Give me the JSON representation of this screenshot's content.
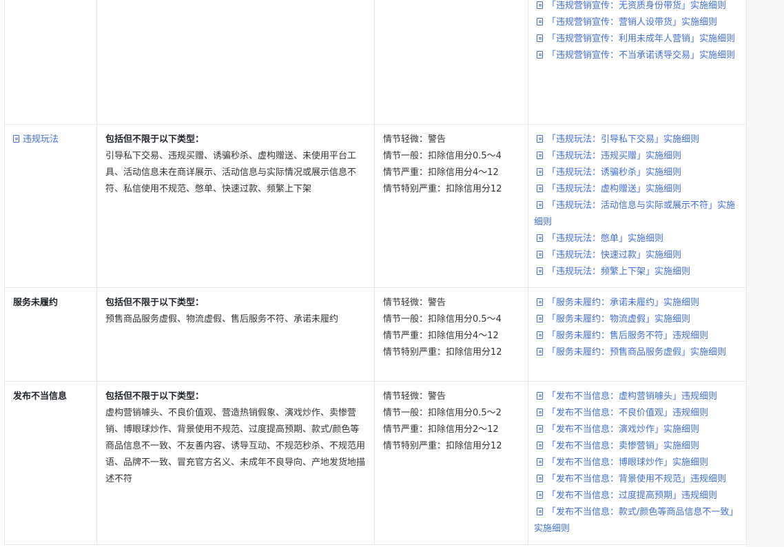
{
  "rows": [
    {
      "type": "",
      "header": "",
      "description": "",
      "penalties": [],
      "rules": [
        "「违规营销宣传：无资质身份带货」实施细则",
        "「违规营销宣传：营销人设带货」实施细则",
        "「违规营销宣传：利用未成年人营销」实施细则",
        "「违规营销宣传：不当承诺诱导交易」实施细则"
      ]
    },
    {
      "type": "违规玩法",
      "header": "包括但不限于以下类型：",
      "description": "引导私下交易、违规买赠、诱骗秒杀、虚构赠送、未使用平台工具、活动信息未在商详展示、活动信息与实际情况或展示信息不符、私信使用不规范、憋单、快速过款、频繁上下架",
      "penalties": [
        "情节轻微：警告",
        "情节一般：扣除信用分0.5～4",
        "情节严重：扣除信用分4～12",
        "情节特别严重：扣除信用分12"
      ],
      "rules": [
        "「违规玩法：引导私下交易」实施细则",
        "「违规玩法：违规买赠」实施细则",
        "「违规玩法：诱骗秒杀」实施细则",
        "「违规玩法：虚构赠送」实施细则",
        "「违规玩法：活动信息与实际或展示不符」实施细则",
        "「违规玩法：憋单」实施细则",
        "「违规玩法：快速过款」实施细则",
        "「违规玩法：频繁上下架」实施细则"
      ]
    },
    {
      "type": "服务未履约",
      "header": "包括但不限于以下类型：",
      "description": "预售商品服务虚假、物流虚假、售后服务不符、承诺未履约",
      "penalties": [
        "情节轻微：警告",
        "情节一般：扣除信用分0.5～4",
        "情节严重：扣除信用分4～12",
        "情节特别严重：扣除信用分12"
      ],
      "rules": [
        "「服务未履约：承诺未履约」实施细则",
        "「服务未履约：物流虚假」实施细则",
        "「服务未履约：售后服务不符」违规细则",
        "「服务未履约：预售商品服务虚假」实施细则"
      ]
    },
    {
      "type": "发布不当信息",
      "header": "包括但不限于以下类型：",
      "description": "虚构营销噱头、不良价值观、营造热销假象、演戏炒作、卖惨营销、博眼球炒作、背景使用不规范、过度提高预期、款式/颜色等商品信息不一致、不友善内容、诱导互动、不规范秒杀、不规范用语、品牌不一致、冒充官方名义、未成年不良导向、产地发货地描述不符",
      "penalties": [
        "情节轻微：警告",
        "情节一般：扣除信用分0.5～2",
        "情节严重：扣除信用分2～12",
        "情节特别严重：扣除信用分12"
      ],
      "rules": [
        "「发布不当信息：虚构营销噱头」违规细则",
        "「发布不当信息：不良价值观」违规细则",
        "「发布不当信息：演戏炒作」实施细则",
        "「发布不当信息：卖惨营销」实施细则",
        "「发布不当信息：博眼球炒作」实施细则",
        "「发布不当信息：背景使用不规范」违规细则",
        "「发布不当信息：过度提高预期」违规细则",
        "「发布不当信息：款式/颜色等商品信息不一致」实施细则"
      ]
    }
  ],
  "icons": {
    "doc": "document-icon"
  },
  "colors": {
    "link": "#3e6fd8",
    "border": "#e4e6ea",
    "text": "#333333"
  }
}
